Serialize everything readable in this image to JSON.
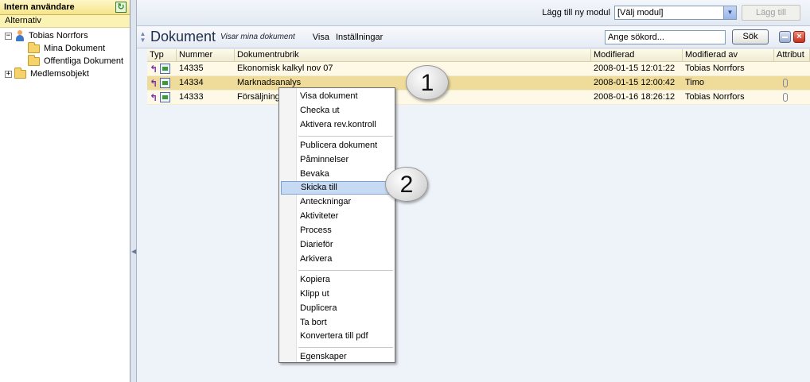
{
  "left": {
    "title": "Intern användare",
    "alt_label": "Alternativ",
    "tree": {
      "user": "Tobias Norrfors",
      "folders": [
        "Mina Dokument",
        "Offentliga Dokument"
      ],
      "members": "Medlemsobjekt"
    }
  },
  "topbar": {
    "add_module_label": "Lägg till ny modul",
    "module_select_value": "[Välj modul]",
    "add_button": "Lägg till"
  },
  "docbar": {
    "title": "Dokument",
    "subtitle": "Visar mina dokument",
    "links": [
      "Visa",
      "Inställningar"
    ],
    "search_placeholder": "Ange sökord...",
    "search_button": "Sök"
  },
  "table": {
    "columns": [
      "Typ",
      "Nummer",
      "Dokumentrubrik",
      "Modifierad",
      "Modifierad av",
      "Attribut"
    ],
    "rows": [
      {
        "number": "14335",
        "title": "Ekonomisk kalkyl nov 07",
        "modified": "2008-01-15 12:01:22",
        "modified_by": "Tobias Norrfors",
        "attachment": false,
        "selected": false
      },
      {
        "number": "14334",
        "title": "Marknadsanalys",
        "modified": "2008-01-15 12:00:42",
        "modified_by": "Timo",
        "attachment": true,
        "selected": true
      },
      {
        "number": "14333",
        "title": "Försäljning",
        "modified": "2008-01-16 18:26:12",
        "modified_by": "Tobias Norrfors",
        "attachment": true,
        "selected": false
      }
    ]
  },
  "context_menu": {
    "groups": [
      [
        "Visa dokument",
        "Checka ut",
        "Aktivera rev.kontroll"
      ],
      [
        "Publicera dokument",
        "Påminnelser",
        "Bevaka",
        "Skicka till",
        "Anteckningar",
        "Aktiviteter",
        "Process",
        "Diarieför",
        "Arkivera"
      ],
      [
        "Kopiera",
        "Klipp ut",
        "Duplicera",
        "Ta bort",
        "Konvertera till pdf"
      ],
      [
        "Egenskaper"
      ]
    ],
    "highlighted": "Skicka till"
  },
  "callouts": [
    "1",
    "2"
  ],
  "colors": {
    "header_yellow": "#f6e58a",
    "row_selected": "#f0dc9a",
    "menu_highlight": "#c7daf3"
  }
}
